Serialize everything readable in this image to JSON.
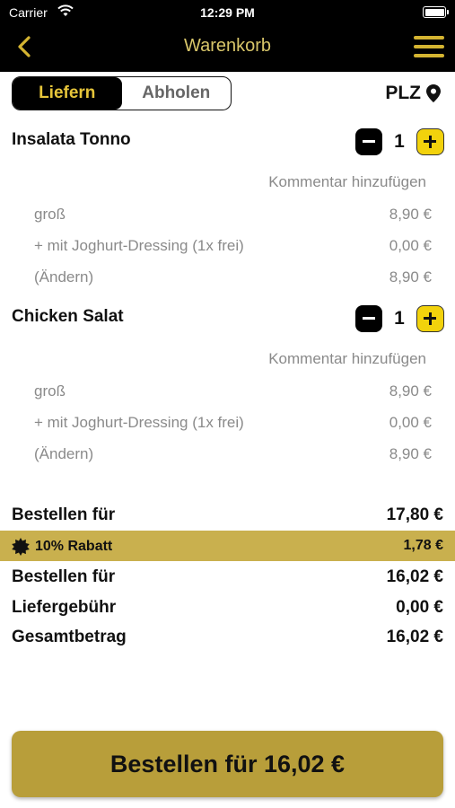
{
  "status_bar": {
    "carrier": "Carrier",
    "time": "12:29 PM"
  },
  "nav": {
    "title": "Warenkorb"
  },
  "mode": {
    "deliver": "Liefern",
    "pickup": "Abholen",
    "selected": "Liefern"
  },
  "plz": "PLZ",
  "items": [
    {
      "name": "Insalata Tonno",
      "quantity": "1",
      "comment_link": "Kommentar hinzufügen",
      "lines": [
        {
          "label": "groß",
          "price": "8,90 €"
        },
        {
          "label": "+ mit Joghurt-Dressing (1x frei)",
          "price": "0,00 €"
        },
        {
          "label": "(Ändern)",
          "price": "8,90 €"
        }
      ]
    },
    {
      "name": "Chicken Salat",
      "quantity": "1",
      "comment_link": "Kommentar hinzufügen",
      "lines": [
        {
          "label": "groß",
          "price": "8,90 €"
        },
        {
          "label": "+ mit Joghurt-Dressing (1x frei)",
          "price": "0,00 €"
        },
        {
          "label": "(Ändern)",
          "price": "8,90 €"
        }
      ]
    }
  ],
  "summary": {
    "subtotal_label": "Bestellen für",
    "subtotal_value": "17,80 €",
    "discount_label": "10% Rabatt",
    "discount_value": "1,78 €",
    "after_discount_label": "Bestellen für",
    "after_discount_value": "16,02 €",
    "delivery_label": "Liefergebühr",
    "delivery_value": "0,00 €",
    "total_label": "Gesamtbetrag",
    "total_value": "16,02 €"
  },
  "order_button": "Bestellen für 16,02 €",
  "colors": {
    "gold": "#d4b431",
    "button": "#b89e3a",
    "discount_band": "#c9b04e"
  }
}
